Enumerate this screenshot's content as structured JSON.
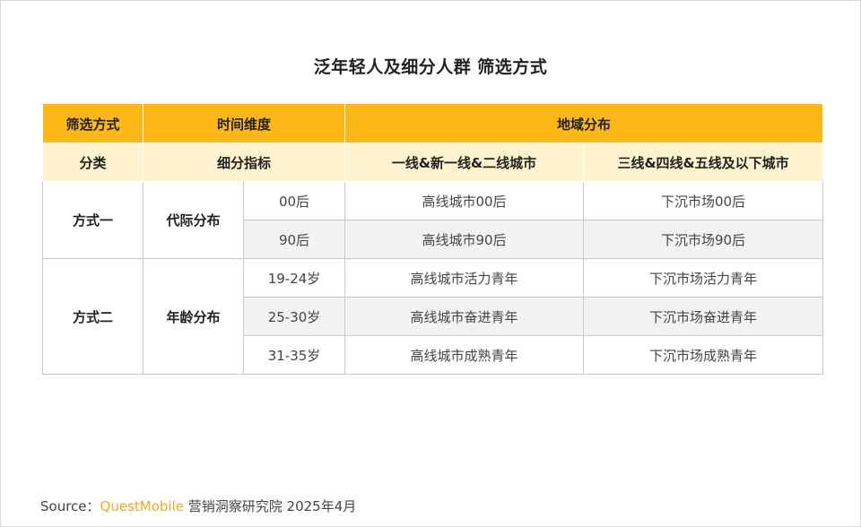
{
  "title": "泛年轻人及细分人群 筛选方式",
  "header": {
    "method": "筛选方式",
    "time_dimension": "时间维度",
    "region": "地域分布",
    "category": "分类",
    "sub_indicator": "细分指标",
    "tier_high": "一线&新一线&二线城市",
    "tier_low": "三线&四线&五线及以下城市"
  },
  "groups": [
    {
      "method": "方式一",
      "dimension": "代际分布",
      "rows": [
        {
          "sub": "00后",
          "high": "高线城市00后",
          "low": "下沉市场00后"
        },
        {
          "sub": "90后",
          "high": "高线城市90后",
          "low": "下沉市场90后"
        }
      ]
    },
    {
      "method": "方式二",
      "dimension": "年龄分布",
      "rows": [
        {
          "sub": "19-24岁",
          "high": "高线城市活力青年",
          "low": "下沉市场活力青年"
        },
        {
          "sub": "25-30岁",
          "high": "高线城市奋进青年",
          "low": "下沉市场奋进青年"
        },
        {
          "sub": "31-35岁",
          "high": "高线城市成熟青年",
          "low": "下沉市场成熟青年"
        }
      ]
    }
  ],
  "source": {
    "prefix": "Source：",
    "brand": "QuestMobile",
    "suffix": " 营销洞察研究院 2025年4月"
  },
  "colors": {
    "header_primary": "#fbb817",
    "header_secondary": "#fef2cf",
    "alt_row": "#f2f2f2",
    "brand": "#f5a623"
  }
}
